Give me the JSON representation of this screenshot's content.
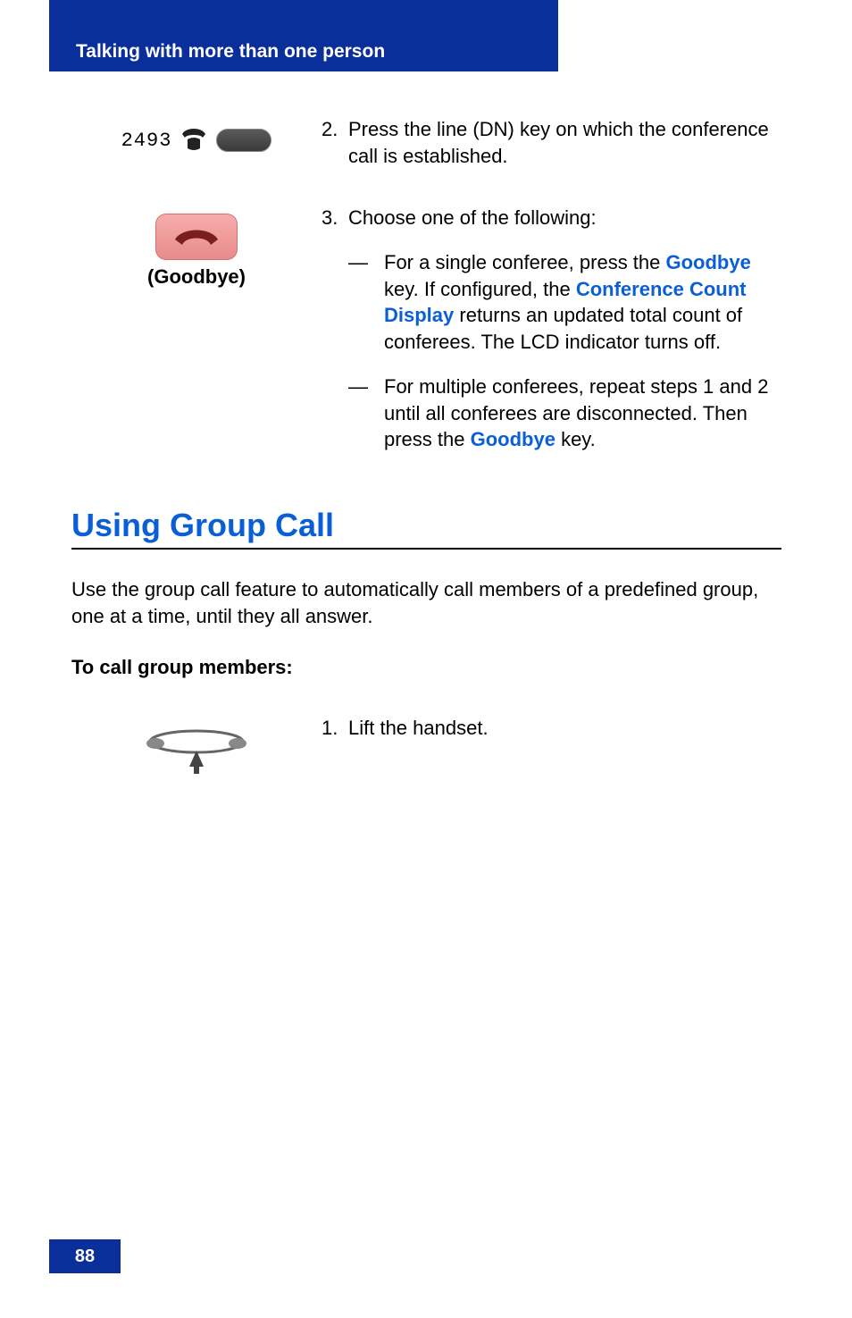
{
  "header": {
    "title": "Talking with more than one person"
  },
  "step2": {
    "number": "2.",
    "text": "Press the line (DN) key on which the conference call is established.",
    "digits": "2493"
  },
  "step3": {
    "number": "3.",
    "intro": "Choose one of the following:",
    "key_label": "(Goodbye)",
    "bullet1": {
      "pre": "For a single conferee, press the ",
      "kw1": "Goodbye",
      "mid1": " key. If configured, the ",
      "kw2": "Conference Count Display",
      "post": " returns an updated total count of conferees. The LCD indicator turns off."
    },
    "bullet2": {
      "pre": "For multiple conferees, repeat steps 1 and 2 until all conferees are disconnected. Then press the ",
      "kw": "Goodbye",
      "post": " key."
    }
  },
  "section": {
    "heading": "Using Group Call",
    "paragraph": "Use the group call feature to automatically call members of a predefined group, one at a time, until they all answer.",
    "subheading": "To call group members:"
  },
  "step1b": {
    "number": "1.",
    "text": "Lift the handset."
  },
  "footer": {
    "page": "88"
  },
  "dash": "—"
}
